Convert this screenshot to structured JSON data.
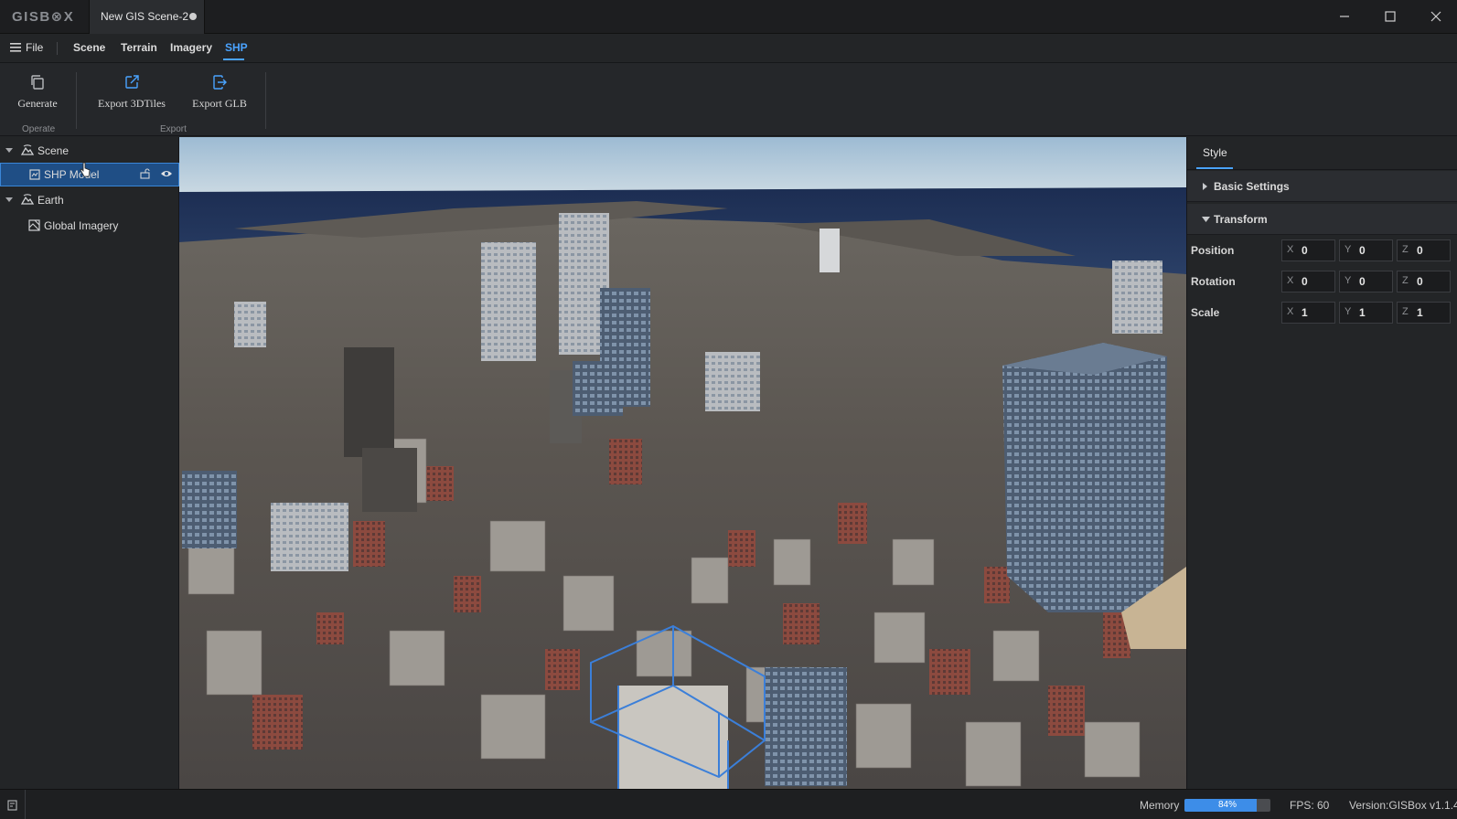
{
  "app": {
    "logo": "GISB⊗X",
    "document_tab": "New GIS Scene-2"
  },
  "menu": {
    "file": "File",
    "items": [
      {
        "label": "Scene",
        "active": false
      },
      {
        "label": "Terrain",
        "active": false
      },
      {
        "label": "Imagery",
        "active": false
      },
      {
        "label": "SHP",
        "active": true
      }
    ]
  },
  "ribbon": {
    "buttons": [
      {
        "label": "Generate",
        "icon": "copy-icon"
      },
      {
        "label": "Export 3DTiles",
        "icon": "external-link-icon"
      },
      {
        "label": "Export GLB",
        "icon": "export-icon"
      }
    ],
    "groups": [
      "Operate",
      "Export"
    ]
  },
  "tree": {
    "items": [
      {
        "label": "Scene",
        "icon": "mountain-icon",
        "level": 0,
        "expanded": true
      },
      {
        "label": "SHP Model",
        "icon": "model-icon",
        "level": 1,
        "selected": true
      },
      {
        "label": "Earth",
        "icon": "mountain-icon",
        "level": 0,
        "expanded": true
      },
      {
        "label": "Global Imagery",
        "icon": "imagery-icon",
        "level": 1
      }
    ]
  },
  "panel": {
    "tab": "Style",
    "sections": [
      {
        "label": "Basic Settings",
        "expanded": false
      },
      {
        "label": "Transform",
        "expanded": true
      }
    ],
    "transform": [
      {
        "label": "Position",
        "x": "0",
        "y": "0",
        "z": "0"
      },
      {
        "label": "Rotation",
        "x": "0",
        "y": "0",
        "z": "0"
      },
      {
        "label": "Scale",
        "x": "1",
        "y": "1",
        "z": "1"
      }
    ],
    "axes": [
      "X",
      "Y",
      "Z"
    ]
  },
  "status": {
    "memory_label": "Memory",
    "memory_percent": 84,
    "memory_text": "84%",
    "fps": "FPS: 60",
    "version": "Version:GISBox v1.1.4"
  },
  "colors": {
    "accent": "#4aa3ff",
    "selection": "#1f4e85",
    "memory_bar": "#3d8de8"
  }
}
